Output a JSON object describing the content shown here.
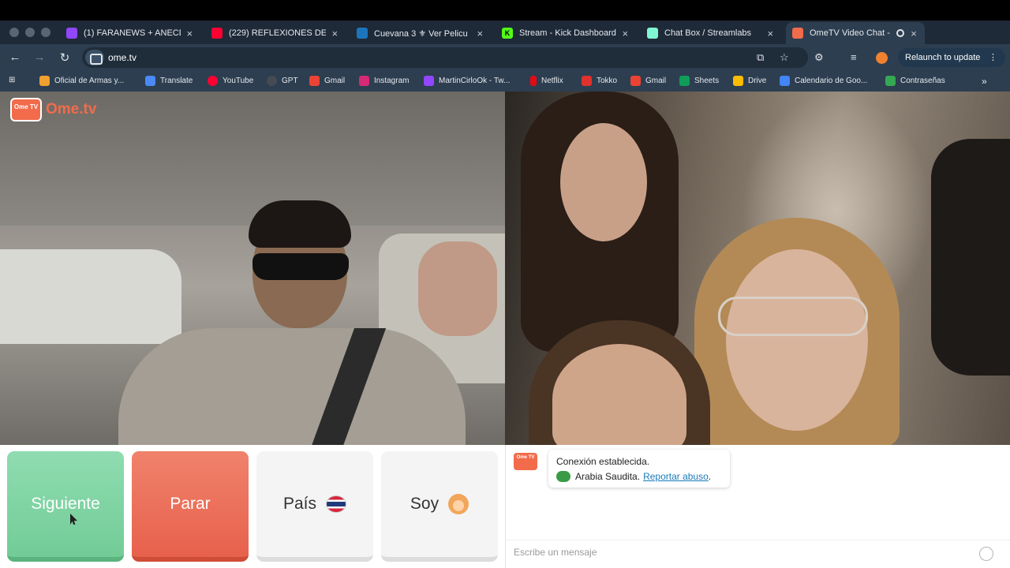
{
  "browser": {
    "tabs": [
      {
        "title": "(1) FARANEWS + ANECD",
        "favicon_color": "#9146ff"
      },
      {
        "title": "(229) REFLEXIONES DE",
        "favicon_color": "#ff0033"
      },
      {
        "title": "Cuevana 3 ⚜ Ver Pelicu",
        "favicon_color": "#1c75bc"
      },
      {
        "title": "Stream - Kick Dashboard",
        "favicon_color": "#53fc18"
      },
      {
        "title": "Chat Box / Streamlabs",
        "favicon_color": "#80f5d2"
      },
      {
        "title": "OmeTV Video Chat -",
        "favicon_color": "#f26b4b"
      }
    ],
    "url": "ome.tv",
    "relaunch_label": "Relaunch to update",
    "bookmarks": [
      {
        "label": "Oficial de Armas y...",
        "color": "#f0a030"
      },
      {
        "label": "Translate",
        "color": "#4a8af4"
      },
      {
        "label": "YouTube",
        "color": "#ff0033"
      },
      {
        "label": "GPT",
        "color": "#444b55"
      },
      {
        "label": "Gmail",
        "color": "#ea4335"
      },
      {
        "label": "Instagram",
        "color": "#d62976"
      },
      {
        "label": "MartinCirloOk - Tw...",
        "color": "#9146ff"
      },
      {
        "label": "Netflix",
        "color": "#e50914"
      },
      {
        "label": "Tokko",
        "color": "#e0312d"
      },
      {
        "label": "Gmail",
        "color": "#ea4335"
      },
      {
        "label": "Sheets",
        "color": "#0f9d58"
      },
      {
        "label": "Drive",
        "color": "#fbbc04"
      },
      {
        "label": "Calendario de Goo...",
        "color": "#4285f4"
      },
      {
        "label": "Contraseñas",
        "color": "#34a853"
      }
    ]
  },
  "site": {
    "logo_text": "Ome.tv",
    "logo_badge": "Ome TV"
  },
  "controls": {
    "next_label": "Siguiente",
    "stop_label": "Parar",
    "country_label": "País",
    "gender_label": "Soy"
  },
  "chat": {
    "status": "Conexión establecida.",
    "country": "Arabia Saudita.",
    "report_label": "Reportar abuso",
    "report_suffix": ".",
    "placeholder": "Escribe un mensaje"
  }
}
